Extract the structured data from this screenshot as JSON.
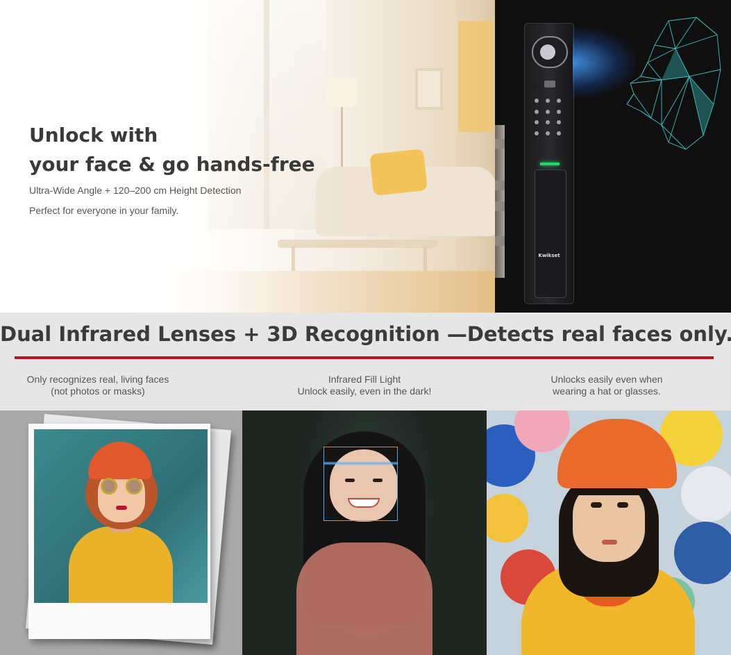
{
  "hero": {
    "title_line1": "Unlock with",
    "title_line2": "your face & go hands-free",
    "subtitle_line1": "Ultra-Wide Angle + 120–200 cm Height Detection",
    "subtitle_line2": "Perfect for everyone in your family.",
    "lock_brand": "Kwikset",
    "led_color": "#26d46a",
    "beam_color": "#46a0ff",
    "mesh_color": "#3fd6d0"
  },
  "banner": {
    "title": "Dual Infrared Lenses + 3D Recognition —Detects real faces only.",
    "rule_color": "#c1121f",
    "features": [
      {
        "line1": "Only recognizes real, living faces",
        "line2": "(not photos or masks)"
      },
      {
        "line1": "Infrared Fill Light",
        "line2": "Unlock easily, even in the dark!"
      },
      {
        "line1": "Unlocks easily even when",
        "line2": "wearing a hat or glasses."
      }
    ]
  },
  "panels": {
    "photo_panel": "printed-photo-of-woman",
    "dark_panel": "face-scan-in-dark",
    "hat_panel": "woman-in-hat-with-balloons",
    "scan_color": "#5aa7e8"
  }
}
